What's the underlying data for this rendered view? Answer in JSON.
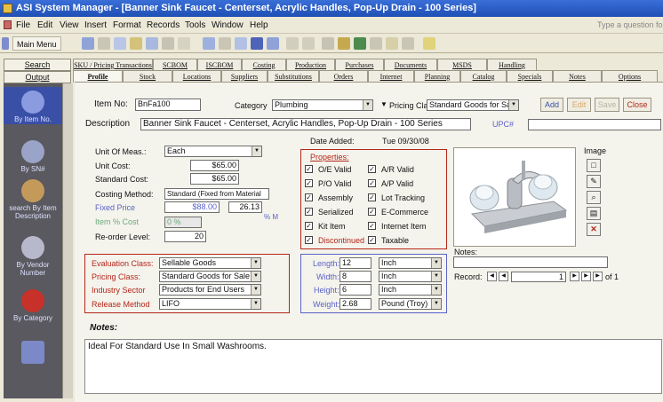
{
  "window": {
    "title": "ASI System Manager - [Banner Sink Faucet - Centerset, Acrylic Handles, Pop-Up Drain - 100 Series]"
  },
  "menu": {
    "items": [
      "File",
      "Edit",
      "View",
      "Insert",
      "Format",
      "Records",
      "Tools",
      "Window",
      "Help"
    ],
    "help_placeholder": "Type a question fo"
  },
  "toolbar": {
    "main_menu_label": "Main Menu"
  },
  "left_panel": {
    "tabs": [
      "Search",
      "Output"
    ],
    "items": [
      {
        "label": "By Item No.",
        "icon": "magnifier-icon"
      },
      {
        "label": "By SN#",
        "icon": "magnifier-icon"
      },
      {
        "label": "search By Item Description",
        "icon": "search-icon"
      },
      {
        "label": "By Vendor Number",
        "icon": "abc-icon"
      },
      {
        "label": "By Category",
        "icon": "shirt-icon"
      },
      {
        "label": "",
        "icon": "calculator-icon"
      }
    ]
  },
  "tabs": {
    "row1": [
      "SKU / Pricing Transactions",
      "SCBOM",
      "ISCBOM",
      "Costing",
      "Production",
      "Purchases",
      "Documents",
      "MSDS",
      "Handling"
    ],
    "row2": [
      "Profile",
      "Stock",
      "Locations",
      "Suppliers",
      "Substitutions",
      "Orders",
      "Internet",
      "Planning",
      "Catalog",
      "Specials",
      "Notes",
      "Options"
    ],
    "active": "Profile"
  },
  "header": {
    "item_no_label": "Item No:",
    "item_no": "BnFa100",
    "category_label": "Category",
    "category": "Plumbing",
    "pricing_class_label": "Pricing Class:",
    "pricing_class": "Standard Goods for Sale",
    "description_label": "Description",
    "description": "Banner Sink Faucet - Centerset, Acrylic Handles, Pop-Up Drain - 100 Series",
    "upc_label": "UPC#",
    "buttons": {
      "add": "Add",
      "edit": "Edit",
      "save": "Save",
      "close": "Close"
    }
  },
  "cost": {
    "uom_label": "Unit Of Meas.:",
    "uom": "Each",
    "unit_cost_label": "Unit Cost:",
    "unit_cost": "$65.00",
    "standard_cost_label": "Standard Cost:",
    "standard_cost": "$65.00",
    "costing_method_label": "Costing Method:",
    "costing_method": "Standard (Fixed from Material",
    "fixed_price_label": "Fixed Price",
    "fixed_price": "$88.00",
    "markup": "26.13",
    "markup_unit": "% M",
    "item_pct_label": "Item % Cost",
    "item_pct": "0 %",
    "reorder_label": "Re-order Level:",
    "reorder": "20"
  },
  "classes": {
    "evaluation_label": "Evaluation Class:",
    "evaluation": "Sellable Goods",
    "pricing_label": "Pricing Class:",
    "pricing": "Standard Goods for Sale",
    "industry_label": "Industry Sector",
    "industry": "Products for End Users",
    "release_label": "Release Method",
    "release": "LIFO"
  },
  "date_added": {
    "label": "Date Added:",
    "value": "Tue 09/30/08"
  },
  "properties": {
    "title": "Properties:",
    "left": [
      {
        "label": "O/E Valid",
        "checked": true
      },
      {
        "label": "P/O Valid",
        "checked": true
      },
      {
        "label": "Assembly",
        "checked": true
      },
      {
        "label": "Serialized",
        "checked": true
      },
      {
        "label": "Kit Item",
        "checked": true
      },
      {
        "label": "Discontinued",
        "checked": true
      }
    ],
    "right": [
      {
        "label": "A/R Valid",
        "checked": true
      },
      {
        "label": "A/P Valid",
        "checked": true
      },
      {
        "label": "Lot Tracking",
        "checked": true
      },
      {
        "label": "E-Commerce",
        "checked": true
      },
      {
        "label": "Internet Item",
        "checked": true
      },
      {
        "label": "Taxable",
        "checked": true
      }
    ]
  },
  "dimensions": [
    {
      "label": "Length:",
      "value": "12",
      "unit": "Inch"
    },
    {
      "label": "Width:",
      "value": "8",
      "unit": "Inch"
    },
    {
      "label": "Height:",
      "value": "6",
      "unit": "Inch"
    },
    {
      "label": "Weight:",
      "value": "2.68",
      "unit": "Pound (Troy)"
    }
  ],
  "image": {
    "label": "Image",
    "notes_label": "Notes:"
  },
  "record": {
    "label": "Record:",
    "current": "1",
    "of_label": "of 1"
  },
  "notes": {
    "label": "Notes:",
    "text": "Ideal For Standard Use In Small Washrooms."
  },
  "colors": {
    "accent_red": "#b4271a",
    "accent_blue": "#5b63c9",
    "title_blue": "#1f4fb4"
  }
}
